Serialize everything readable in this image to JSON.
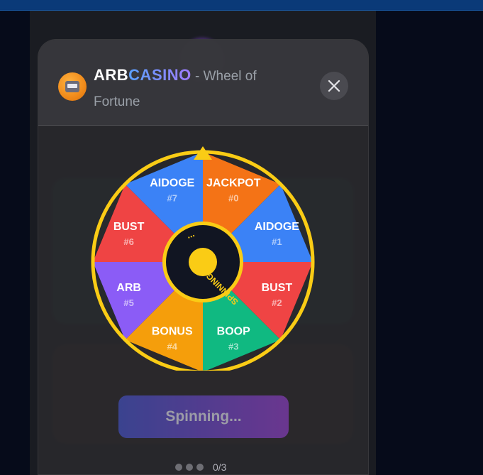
{
  "modal": {
    "brand_a": "ARB",
    "brand_b": "CASINO",
    "subtitle": "- Wheel of Fortune"
  },
  "wheel": {
    "center_label": "SPINNING",
    "center_dots": "...",
    "segments": [
      {
        "label": "JACKPOT",
        "index": "#0",
        "color": "#f47316"
      },
      {
        "label": "AIDOGE",
        "index": "#1",
        "color": "#3b82f6"
      },
      {
        "label": "BUST",
        "index": "#2",
        "color": "#ef4444"
      },
      {
        "label": "BOOP",
        "index": "#3",
        "color": "#10b981"
      },
      {
        "label": "BONUS",
        "index": "#4",
        "color": "#f59e0b"
      },
      {
        "label": "ARB",
        "index": "#5",
        "color": "#8b5cf6"
      },
      {
        "label": "BUST",
        "index": "#6",
        "color": "#ef4444"
      },
      {
        "label": "AIDOGE",
        "index": "#7",
        "color": "#3b82f6"
      }
    ],
    "rim_color": "#facc15"
  },
  "spin_button": {
    "label": "Spinning..."
  },
  "progress": {
    "count_text": "0/3",
    "completed": 0,
    "total": 3
  }
}
